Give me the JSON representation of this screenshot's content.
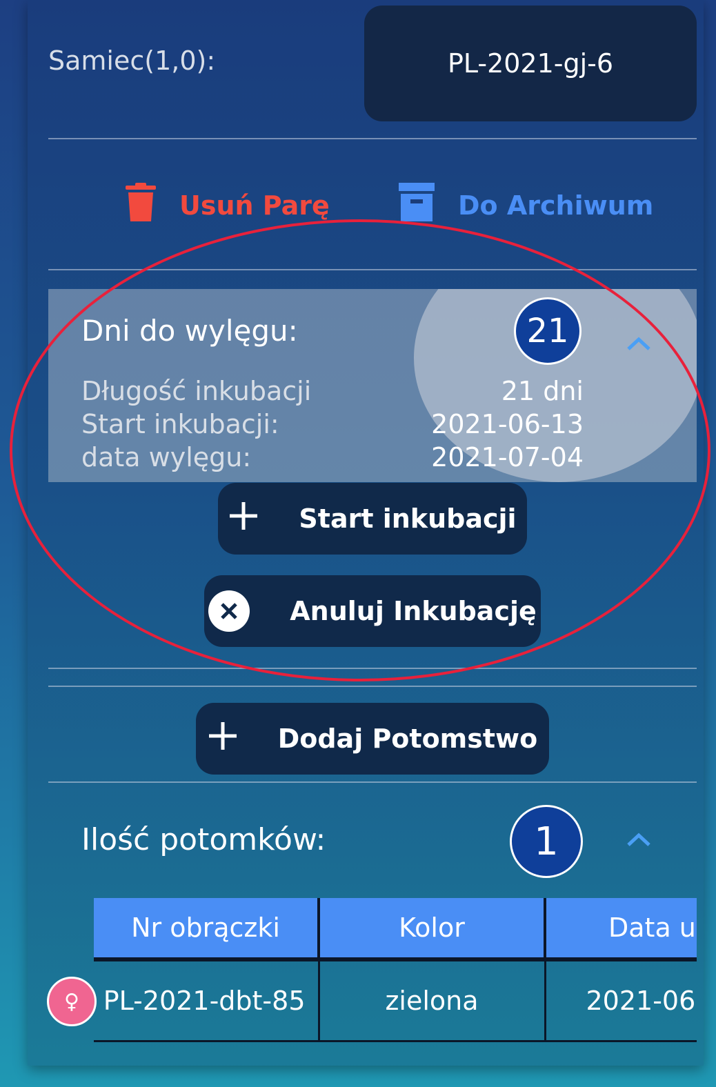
{
  "pair": {
    "male_label": "Samiec(1,0):",
    "male_ring": "PL-2021-gj-6"
  },
  "actions": {
    "delete_label": "Usuń Parę",
    "archive_label": "Do Archiwum"
  },
  "incubation": {
    "title": "Dni do wylęgu:",
    "days_left": "21",
    "rows": [
      {
        "label": "Długość inkubacji",
        "value": "21 dni"
      },
      {
        "label": "Start inkubacji:",
        "value": "2021-06-13"
      },
      {
        "label": "data wylęgu:",
        "value": "2021-07-04"
      }
    ],
    "start_button": "Start inkubacji",
    "cancel_button": "Anuluj Inkubację"
  },
  "offspring": {
    "add_button": "Dodaj Potomstwo",
    "title": "Ilość potomków:",
    "count": "1",
    "columns": [
      "Nr obrączki",
      "Kolor",
      "Data ur"
    ],
    "rows": [
      {
        "ring": "PL-2021-dbt-85",
        "color": "zielona",
        "date": "2021-06-"
      }
    ]
  },
  "colors": {
    "delete": "#f24a3e",
    "archive": "#4a8ef5",
    "badge": "#0f3f9a",
    "annotation": "#e8213b",
    "female": "#f06591"
  },
  "icons": {
    "female_symbol": "♀"
  }
}
